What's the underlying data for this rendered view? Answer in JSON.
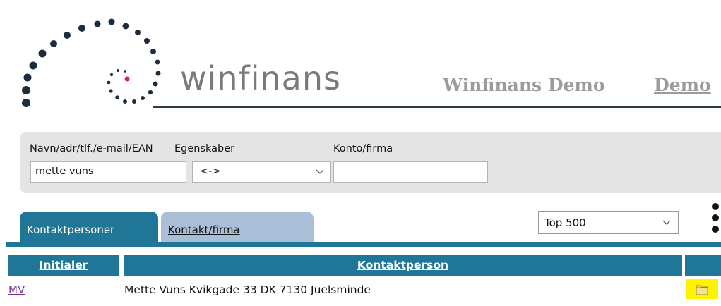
{
  "header": {
    "brand": "winfinans",
    "company": "Winfinans Demo",
    "user": "Demo"
  },
  "search": {
    "name_label": "Navn/adr/tlf./e-mail/EAN",
    "name_value": "mette vuns",
    "properties_label": "Egenskaber",
    "properties_value": "<->",
    "account_label": "Konto/firma",
    "account_value": ""
  },
  "tabs": [
    {
      "label": "Kontaktpersoner",
      "active": true
    },
    {
      "label": "Kontakt/firma",
      "active": false
    }
  ],
  "limit_select": {
    "value": "Top 500"
  },
  "table": {
    "columns": [
      "Initialer",
      "Kontaktperson",
      ""
    ],
    "rows": [
      {
        "initials": "MV",
        "contact": "Mette Vuns Kvikgade 33 DK 7130 Juelsminde",
        "action_icon": "folder-icon"
      }
    ]
  },
  "colors": {
    "accent_blue": "#1f7696",
    "inactive_tab": "#a9bfd8",
    "logo_dot_pink": "#e0157a",
    "logo_dot_dark": "#1e2d3d",
    "highlight_yellow": "#fff200"
  },
  "icons": [
    "logo-spiral-icon",
    "chevron-down-icon",
    "more-vertical-icon",
    "folder-icon"
  ]
}
